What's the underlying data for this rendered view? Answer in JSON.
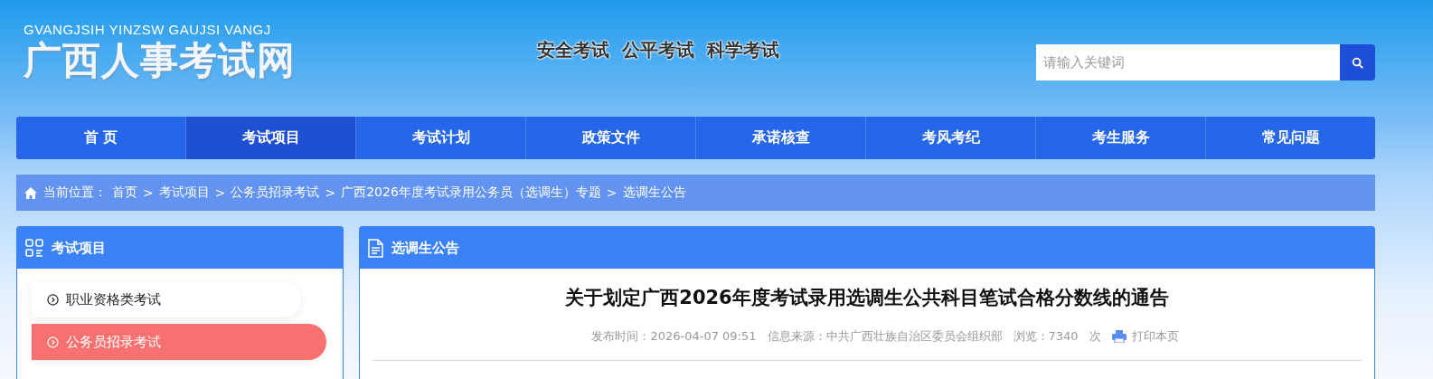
{
  "header": {
    "logo_subtitle": "GVANGJSIH YINZSW GAUJSI VANGJ",
    "logo_title": "广西人事考试网",
    "slogans": [
      "安全考试",
      "公平考试",
      "科学考试"
    ],
    "search": {
      "placeholder": "请输入关键词"
    }
  },
  "nav": [
    {
      "label": "首 页",
      "selected": false
    },
    {
      "label": "考试项目",
      "selected": true
    },
    {
      "label": "考试计划",
      "selected": false
    },
    {
      "label": "政策文件",
      "selected": false
    },
    {
      "label": "承诺核查",
      "selected": false
    },
    {
      "label": "考风考纪",
      "selected": false
    },
    {
      "label": "考生服务",
      "selected": false
    },
    {
      "label": "常见问题",
      "selected": false
    }
  ],
  "breadcrumb": {
    "label": "当前位置：",
    "separator": ">",
    "items": [
      "首页",
      "考试项目",
      "公务员招录考试",
      "广西2026年度考试录用公务员（选调生）专题",
      "选调生公告"
    ]
  },
  "sidebar": {
    "title": "考试项目",
    "items": [
      {
        "label": "职业资格类考试",
        "selected": false
      },
      {
        "label": "公务员招录考试",
        "selected": true
      }
    ]
  },
  "article": {
    "section_title": "选调生公告",
    "title": "关于划定广西2026年度考试录用选调生公共科目笔试合格分数线的通告",
    "meta": [
      "发布时间：2026-04-07 09:51",
      "信息来源：中共广西壮族自治区委员会组织部",
      "浏览：7340",
      "次"
    ],
    "print": "打印本页"
  }
}
